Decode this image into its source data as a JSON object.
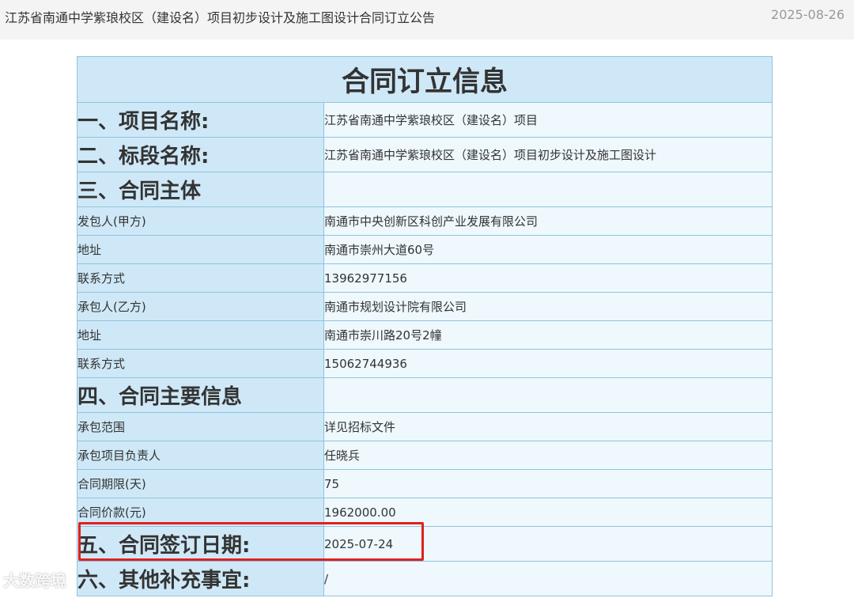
{
  "header": {
    "title": "江苏省南通中学紫琅校区（建设名）项目初步设计及施工图设计合同订立公告",
    "date": "2025-08-26"
  },
  "table": {
    "caption": "合同订立信息",
    "project_label": "一、项目名称:",
    "project_value": "江苏省南通中学紫琅校区（建设名）项目",
    "section_label": "二、标段名称:",
    "section_value": "江苏省南通中学紫琅校区（建设名）项目初步设计及施工图设计",
    "parties_heading": "三、合同主体",
    "employer_label": "发包人(甲方)",
    "employer_value": "南通市中央创新区科创产业发展有限公司",
    "employer_address_label": "地址",
    "employer_address_value": "南通市崇州大道60号",
    "employer_contact_label": "联系方式",
    "employer_contact_value": "13962977156",
    "contractor_label": "承包人(乙方)",
    "contractor_value": "南通市规划设计院有限公司",
    "contractor_address_label": "地址",
    "contractor_address_value": "南通市崇川路20号2幢",
    "contractor_contact_label": "联系方式",
    "contractor_contact_value": "15062744936",
    "main_info_heading": "四、合同主要信息",
    "scope_label": "承包范围",
    "scope_value": "详见招标文件",
    "manager_label": "承包项目负责人",
    "manager_value": "任晓兵",
    "term_label": "合同期限(天)",
    "term_value": "75",
    "price_label": "合同价款(元)",
    "price_value": "1962000.00",
    "sign_date_label": "五、合同签订日期:",
    "sign_date_value": "2025-07-24",
    "other_label": "六、其他补充事宜:",
    "other_value": "/"
  },
  "watermark": "大数跨境",
  "colors": {
    "label_bg": "#cfe8f7",
    "value_bg": "#eef8fd",
    "border": "#8fc4dc",
    "highlight": "#e02020"
  }
}
